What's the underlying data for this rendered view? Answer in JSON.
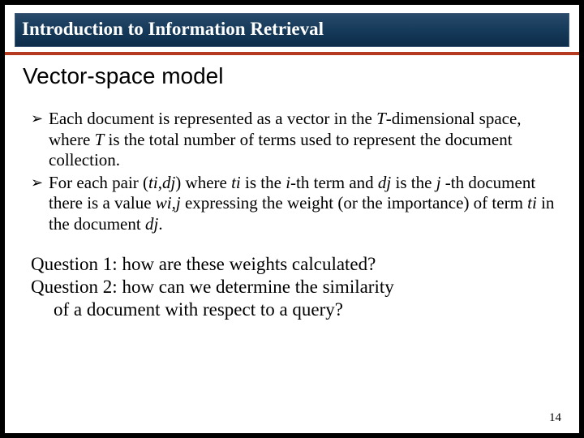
{
  "header": {
    "title": "Introduction to Information Retrieval"
  },
  "slide": {
    "title": "Vector-space model",
    "bullets": {
      "b1": {
        "pre": "Each document is represented as a vector in the ",
        "it1": "T",
        "mid1": "-dimensional space, where ",
        "it2": "T",
        "post": " is the total number of terms used to represent the document collection."
      },
      "b2": {
        "pre": "For each pair (",
        "it1": "ti",
        "c1": ",",
        "it2": "dj",
        "mid1": ") where ",
        "it3": "ti",
        "mid2": " is the ",
        "it4": "i",
        "mid3": "-th term and ",
        "it5": "dj",
        "mid4": " is the ",
        "it6": "j",
        "mid5": " -th document there is a value ",
        "it7": "wi,j",
        "mid6": " expressing the weight (or the importance) of term ",
        "it8": "ti",
        "mid7": " in the document ",
        "it9": "dj",
        "post": "."
      }
    },
    "questions": {
      "q1": "Question 1: how are these weights calculated?",
      "q2a": "Question 2: how can we determine the similarity",
      "q2b": "of a document with respect to a query?"
    },
    "page_number": "14"
  }
}
